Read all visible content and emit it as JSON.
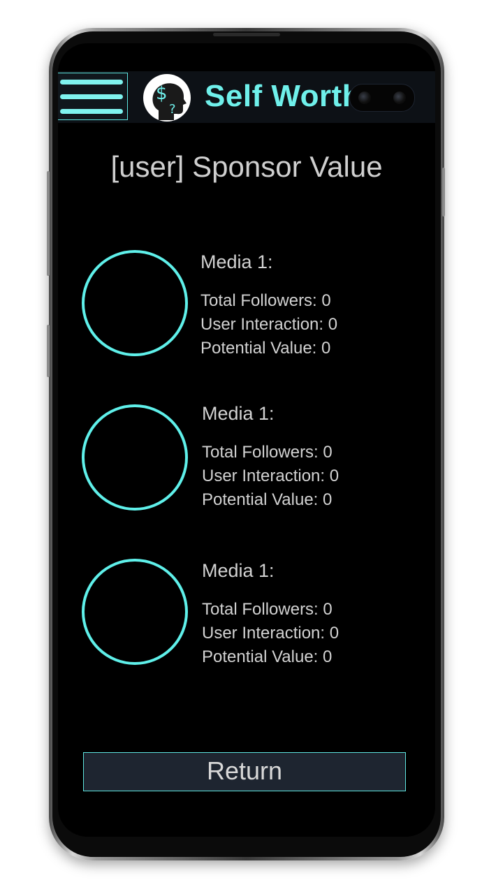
{
  "header": {
    "app_title": "Self Worth",
    "logo_symbols": {
      "dollar": "$",
      "question": "?"
    }
  },
  "page": {
    "title": "[user] Sponsor Value"
  },
  "media_items": [
    {
      "title": "Media 1:",
      "total_followers": "Total Followers: 0",
      "user_interaction": "User Interaction: 0",
      "potential_value": "Potential Value: 0"
    },
    {
      "title": "Media 1:",
      "total_followers": "Total Followers: 0",
      "user_interaction": "User Interaction: 0",
      "potential_value": "Potential Value: 0"
    },
    {
      "title": "Media 1:",
      "total_followers": "Total Followers: 0",
      "user_interaction": "User Interaction: 0",
      "potential_value": "Potential Value: 0"
    }
  ],
  "actions": {
    "return_label": "Return"
  },
  "colors": {
    "accent": "#6ff0eb",
    "background": "#000000",
    "header_background": "#0d1116",
    "button_background": "#1e2530",
    "text": "#d2d2d2"
  }
}
